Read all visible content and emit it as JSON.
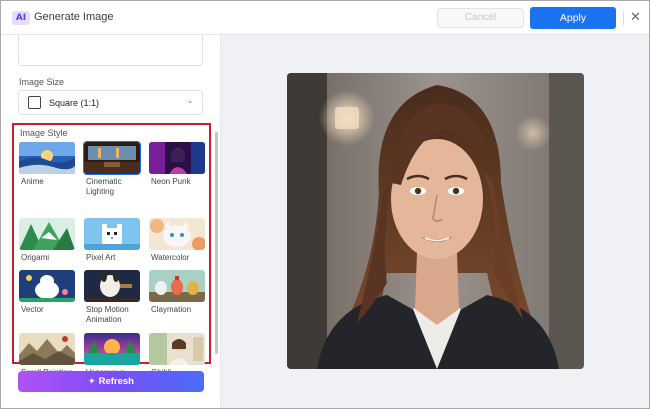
{
  "window": {
    "title": "Generate Image",
    "badge": "AI"
  },
  "toolbar": {
    "cancel_label": "Cancel",
    "apply_label": "Apply",
    "close_glyph": "✕"
  },
  "image_size": {
    "label": "Image Size",
    "value": "Square (1:1)",
    "chevron": "⌄"
  },
  "image_style": {
    "label": "Image Style",
    "selected": "Cinematic Lighting",
    "items": [
      {
        "label": "Anime"
      },
      {
        "label": "Cinematic Lighting"
      },
      {
        "label": "Neon Punk"
      },
      {
        "label": "Origami"
      },
      {
        "label": "Pixel Art"
      },
      {
        "label": "Watercolor"
      },
      {
        "label": "Vector"
      },
      {
        "label": "Stop Motion Animation"
      },
      {
        "label": "Claymation"
      },
      {
        "label": "Scroll Painting"
      },
      {
        "label": "Vaporwave"
      },
      {
        "label": "Ghibli"
      }
    ]
  },
  "refresh": {
    "label": "Refresh",
    "icon": "✦"
  },
  "colors": {
    "accent": "#1a73f0",
    "highlight_border": "#c81e2a",
    "badge_bg": "#e4ddff"
  }
}
